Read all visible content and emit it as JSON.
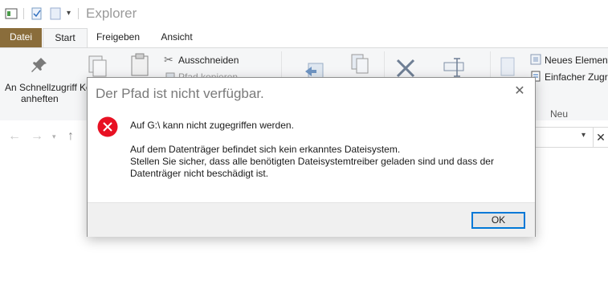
{
  "window": {
    "title": "Explorer"
  },
  "tabs": {
    "datei": "Datei",
    "start": "Start",
    "freigeben": "Freigeben",
    "ansicht": "Ansicht"
  },
  "ribbon": {
    "pin_line1": "An Schnellzugriff",
    "pin_line2": "anheften",
    "copy_partial": "Ko",
    "cut": "Ausschneiden",
    "copy_path": "Pfad kopieren",
    "new_item": "Neues Element",
    "easy_access": "Einfacher Zugriff",
    "group_new": "Neu"
  },
  "dialog": {
    "title": "Der Pfad ist nicht verfügbar.",
    "message_heading": "Auf G:\\ kann nicht zugegriffen werden.",
    "message_line1": "Auf dem Datenträger befindet sich kein erkanntes Dateisystem.",
    "message_line2": "Stellen Sie sicher, dass alle benötigten Dateisystemtreiber geladen sind und dass der",
    "message_line3": "Datenträger nicht beschädigt ist.",
    "ok_label": "OK"
  },
  "colors": {
    "datei_tab": "#8a6d3b",
    "error_red": "#e81123",
    "ok_border": "#0078d7"
  }
}
